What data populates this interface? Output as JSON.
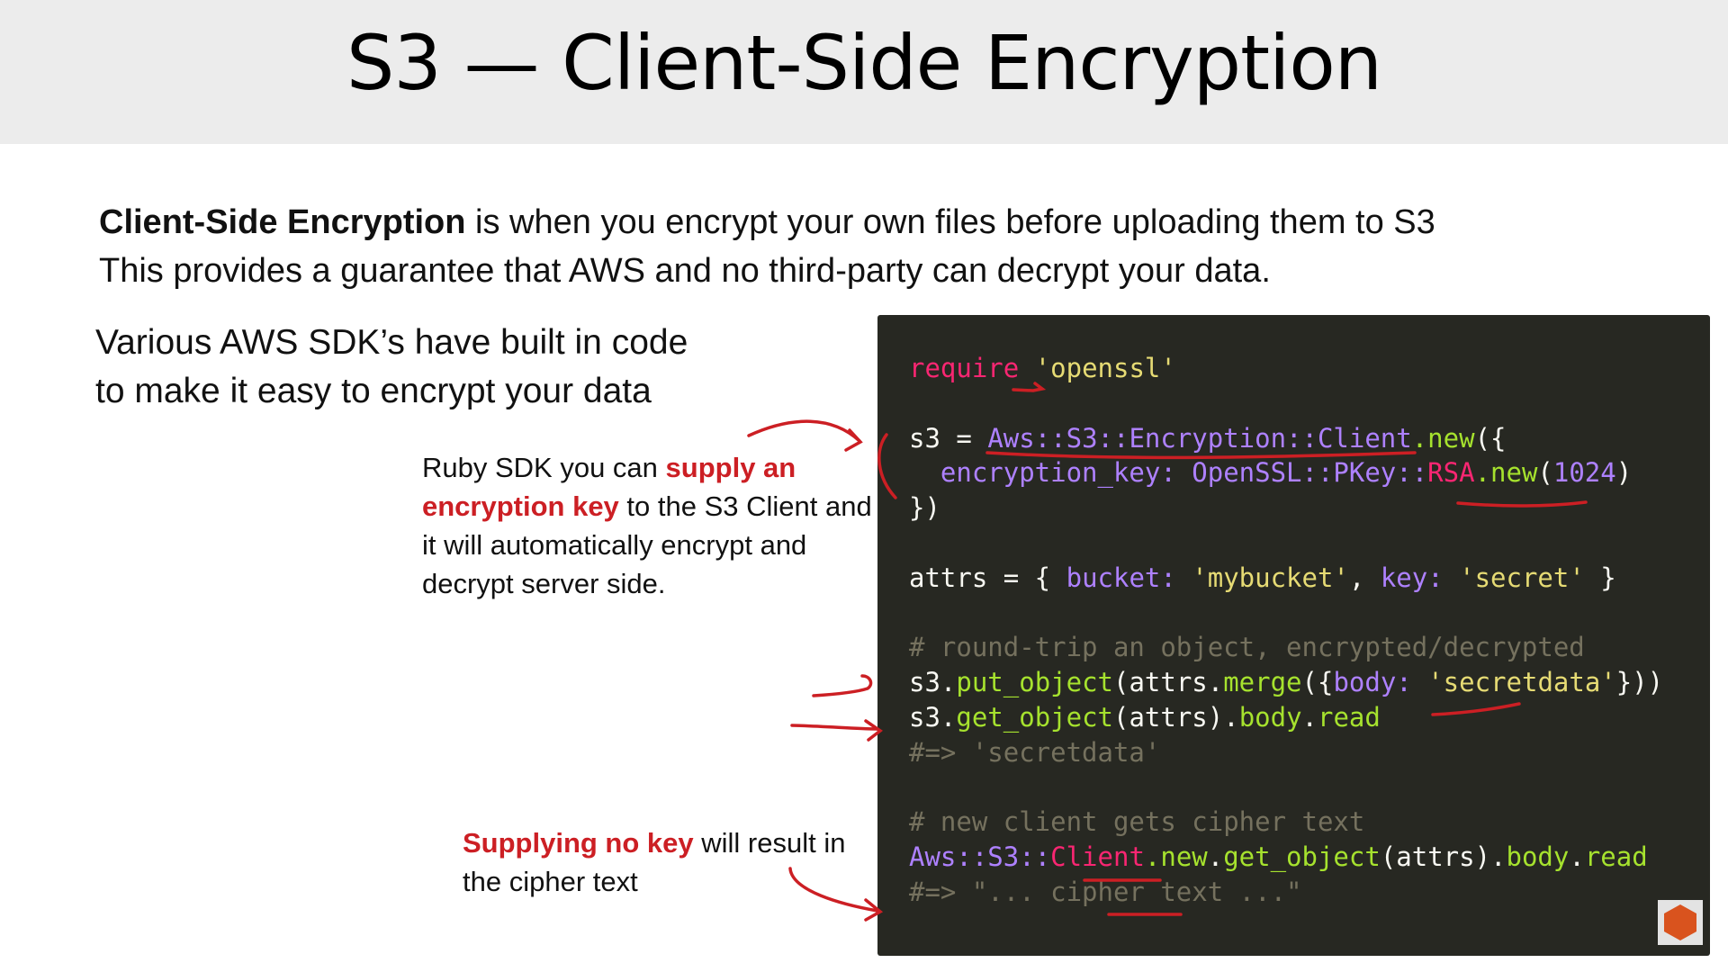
{
  "slide": {
    "title": "S3 — Client-Side Encryption",
    "intro": {
      "bold_term": "Client-Side Encryption",
      "line1_rest": " is when you encrypt your own files before uploading them to S3",
      "line2": "This provides a guarantee that AWS and no third-party can decrypt your data."
    },
    "various": {
      "line1": "Various AWS SDK’s have built in code",
      "line2": "to make it easy to encrypt your data"
    },
    "ruby_note": {
      "before": "Ruby SDK you can ",
      "highlight": "supply an encryption key",
      "after": " to the S3 Client and it will automatically encrypt and decrypt server side."
    },
    "nokey_note": {
      "highlight": "Supplying no key",
      "after": " will result in the cipher text"
    }
  },
  "code": {
    "require_kw": "require",
    "require_arg": "'openssl'",
    "s3_assign": "s3 = ",
    "client_class": "Aws::S3::Encryption::Client",
    "dot_new": ".new",
    "open_args": "({",
    "enc_key_label": "  encryption_key:",
    "pkey_prefix": " OpenSSL::PKey::",
    "rsa": "RSA",
    "new_call": ".new",
    "paren_open": "(",
    "bits": "1024",
    "paren_close": ")",
    "close_block": "})",
    "attrs_start": "attrs = { ",
    "bucket_label": "bucket:",
    "bucket_val": " 'mybucket'",
    "comma": ", ",
    "key_label": "key:",
    "key_val": " 'secret'",
    "attrs_end": " }",
    "comment_roundtrip": "# round-trip an object, encrypted/decrypted",
    "put_prefix": "s3.",
    "put_method": "put_object",
    "put_args_a": "(attrs.",
    "merge": "merge",
    "put_args_b": "({",
    "body_label": "body:",
    "body_val": " 'secretdata'",
    "put_args_c": "}))",
    "get_prefix": "s3.",
    "get_method": "get_object",
    "get_args": "(attrs).",
    "body_m": "body",
    "dot": ".",
    "read_m": "read",
    "result_secret": "#=> 'secretdata'",
    "comment_newclient": "# new client gets cipher text",
    "aws_prefix": "Aws::S3::",
    "client_word": "Client",
    "new_m2": ".new",
    "dot2": ".",
    "get_method2": "get_object",
    "get_args2": "(attrs).",
    "body_m2": "body",
    "dot3": ".",
    "read_m2": "read",
    "result_cipher": "#=> \"... cipher text ...\""
  },
  "colors": {
    "header_bg": "#ececec",
    "code_bg": "#272822",
    "accent_red": "#cc1f24",
    "keyword": "#f92672",
    "string": "#e6db74",
    "comment": "#75715e",
    "class_purple": "#ae81ff",
    "method_green": "#a6e22e",
    "logo_orange": "#d9531e"
  }
}
